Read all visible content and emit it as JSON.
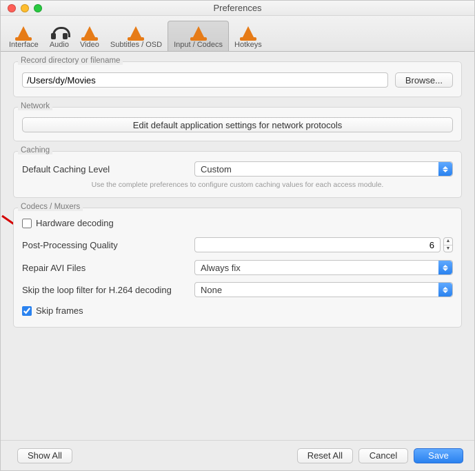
{
  "window": {
    "title": "Preferences"
  },
  "toolbar": {
    "items": [
      {
        "label": "Interface"
      },
      {
        "label": "Audio"
      },
      {
        "label": "Video"
      },
      {
        "label": "Subtitles / OSD"
      },
      {
        "label": "Input / Codecs"
      },
      {
        "label": "Hotkeys"
      }
    ]
  },
  "record": {
    "legend": "Record directory or filename",
    "path": "/Users/dy/Movies",
    "browse": "Browse..."
  },
  "network": {
    "legend": "Network",
    "button": "Edit default application settings for network protocols"
  },
  "caching": {
    "legend": "Caching",
    "label": "Default Caching Level",
    "value": "Custom",
    "hint": "Use the complete preferences to configure custom caching values for each access module."
  },
  "codecs": {
    "legend": "Codecs / Muxers",
    "hw_decoding": {
      "label": "Hardware decoding",
      "checked": false
    },
    "ppq": {
      "label": "Post-Processing Quality",
      "value": "6"
    },
    "repair": {
      "label": "Repair AVI Files",
      "value": "Always fix"
    },
    "loop": {
      "label": "Skip the loop filter for H.264 decoding",
      "value": "None"
    },
    "skip_frames": {
      "label": "Skip frames",
      "checked": true
    }
  },
  "footer": {
    "show_all": "Show All",
    "reset_all": "Reset All",
    "cancel": "Cancel",
    "save": "Save"
  }
}
